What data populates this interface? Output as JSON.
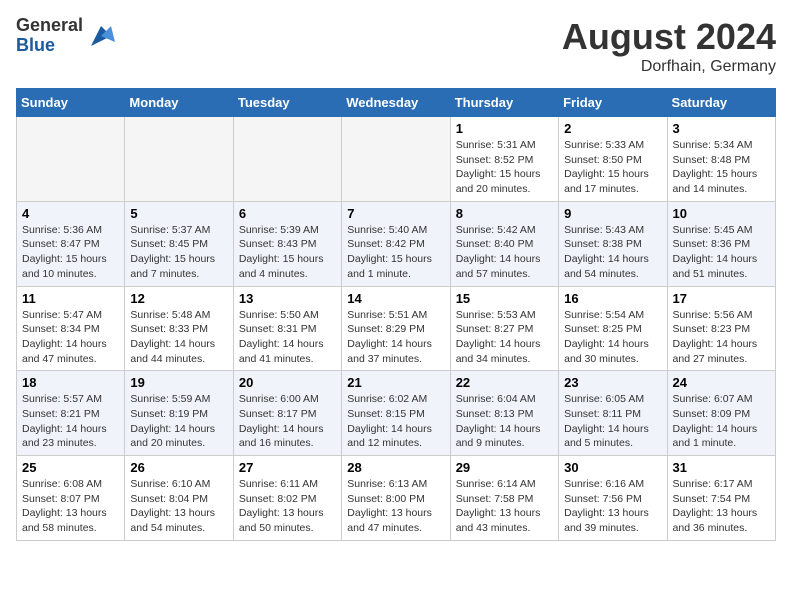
{
  "header": {
    "logo_general": "General",
    "logo_blue": "Blue",
    "month_title": "August 2024",
    "location": "Dorfhain, Germany"
  },
  "days_of_week": [
    "Sunday",
    "Monday",
    "Tuesday",
    "Wednesday",
    "Thursday",
    "Friday",
    "Saturday"
  ],
  "weeks": [
    [
      {
        "day": "",
        "empty": true
      },
      {
        "day": "",
        "empty": true
      },
      {
        "day": "",
        "empty": true
      },
      {
        "day": "",
        "empty": true
      },
      {
        "day": "1",
        "sunrise": "5:31 AM",
        "sunset": "8:52 PM",
        "daylight": "15 hours and 20 minutes."
      },
      {
        "day": "2",
        "sunrise": "5:33 AM",
        "sunset": "8:50 PM",
        "daylight": "15 hours and 17 minutes."
      },
      {
        "day": "3",
        "sunrise": "5:34 AM",
        "sunset": "8:48 PM",
        "daylight": "15 hours and 14 minutes."
      }
    ],
    [
      {
        "day": "4",
        "sunrise": "5:36 AM",
        "sunset": "8:47 PM",
        "daylight": "15 hours and 10 minutes."
      },
      {
        "day": "5",
        "sunrise": "5:37 AM",
        "sunset": "8:45 PM",
        "daylight": "15 hours and 7 minutes."
      },
      {
        "day": "6",
        "sunrise": "5:39 AM",
        "sunset": "8:43 PM",
        "daylight": "15 hours and 4 minutes."
      },
      {
        "day": "7",
        "sunrise": "5:40 AM",
        "sunset": "8:42 PM",
        "daylight": "15 hours and 1 minute."
      },
      {
        "day": "8",
        "sunrise": "5:42 AM",
        "sunset": "8:40 PM",
        "daylight": "14 hours and 57 minutes."
      },
      {
        "day": "9",
        "sunrise": "5:43 AM",
        "sunset": "8:38 PM",
        "daylight": "14 hours and 54 minutes."
      },
      {
        "day": "10",
        "sunrise": "5:45 AM",
        "sunset": "8:36 PM",
        "daylight": "14 hours and 51 minutes."
      }
    ],
    [
      {
        "day": "11",
        "sunrise": "5:47 AM",
        "sunset": "8:34 PM",
        "daylight": "14 hours and 47 minutes."
      },
      {
        "day": "12",
        "sunrise": "5:48 AM",
        "sunset": "8:33 PM",
        "daylight": "14 hours and 44 minutes."
      },
      {
        "day": "13",
        "sunrise": "5:50 AM",
        "sunset": "8:31 PM",
        "daylight": "14 hours and 41 minutes."
      },
      {
        "day": "14",
        "sunrise": "5:51 AM",
        "sunset": "8:29 PM",
        "daylight": "14 hours and 37 minutes."
      },
      {
        "day": "15",
        "sunrise": "5:53 AM",
        "sunset": "8:27 PM",
        "daylight": "14 hours and 34 minutes."
      },
      {
        "day": "16",
        "sunrise": "5:54 AM",
        "sunset": "8:25 PM",
        "daylight": "14 hours and 30 minutes."
      },
      {
        "day": "17",
        "sunrise": "5:56 AM",
        "sunset": "8:23 PM",
        "daylight": "14 hours and 27 minutes."
      }
    ],
    [
      {
        "day": "18",
        "sunrise": "5:57 AM",
        "sunset": "8:21 PM",
        "daylight": "14 hours and 23 minutes."
      },
      {
        "day": "19",
        "sunrise": "5:59 AM",
        "sunset": "8:19 PM",
        "daylight": "14 hours and 20 minutes."
      },
      {
        "day": "20",
        "sunrise": "6:00 AM",
        "sunset": "8:17 PM",
        "daylight": "14 hours and 16 minutes."
      },
      {
        "day": "21",
        "sunrise": "6:02 AM",
        "sunset": "8:15 PM",
        "daylight": "14 hours and 12 minutes."
      },
      {
        "day": "22",
        "sunrise": "6:04 AM",
        "sunset": "8:13 PM",
        "daylight": "14 hours and 9 minutes."
      },
      {
        "day": "23",
        "sunrise": "6:05 AM",
        "sunset": "8:11 PM",
        "daylight": "14 hours and 5 minutes."
      },
      {
        "day": "24",
        "sunrise": "6:07 AM",
        "sunset": "8:09 PM",
        "daylight": "14 hours and 1 minute."
      }
    ],
    [
      {
        "day": "25",
        "sunrise": "6:08 AM",
        "sunset": "8:07 PM",
        "daylight": "13 hours and 58 minutes."
      },
      {
        "day": "26",
        "sunrise": "6:10 AM",
        "sunset": "8:04 PM",
        "daylight": "13 hours and 54 minutes."
      },
      {
        "day": "27",
        "sunrise": "6:11 AM",
        "sunset": "8:02 PM",
        "daylight": "13 hours and 50 minutes."
      },
      {
        "day": "28",
        "sunrise": "6:13 AM",
        "sunset": "8:00 PM",
        "daylight": "13 hours and 47 minutes."
      },
      {
        "day": "29",
        "sunrise": "6:14 AM",
        "sunset": "7:58 PM",
        "daylight": "13 hours and 43 minutes."
      },
      {
        "day": "30",
        "sunrise": "6:16 AM",
        "sunset": "7:56 PM",
        "daylight": "13 hours and 39 minutes."
      },
      {
        "day": "31",
        "sunrise": "6:17 AM",
        "sunset": "7:54 PM",
        "daylight": "13 hours and 36 minutes."
      }
    ]
  ],
  "labels": {
    "sunrise": "Sunrise:",
    "sunset": "Sunset:",
    "daylight": "Daylight hours"
  }
}
